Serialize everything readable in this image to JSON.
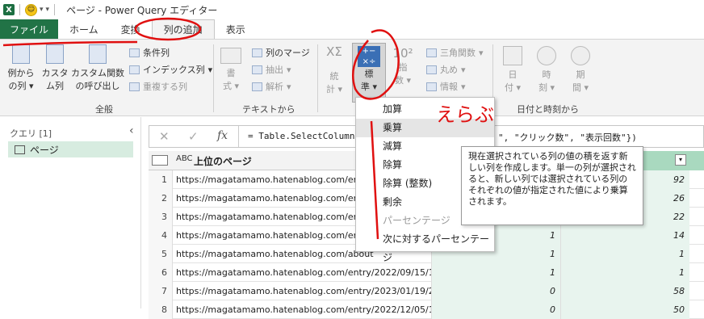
{
  "window": {
    "title": "ページ - Power Query エディター"
  },
  "tabs": [
    {
      "label": "ファイル"
    },
    {
      "label": "ホーム"
    },
    {
      "label": "変換"
    },
    {
      "label": "列の追加"
    },
    {
      "label": "表示"
    }
  ],
  "ribbon": {
    "example_col": "例から",
    "example_col2": "の列",
    "custom_col": "カスタ",
    "custom_col2": "ム列",
    "custom_fn": "カスタム関数",
    "custom_fn2": "の呼び出し",
    "conditional": "条件列",
    "index": "インデックス列",
    "duplicate": "重複する列",
    "group_general": "全般",
    "format": "書",
    "format2": "式",
    "merge": "列のマージ",
    "extract": "抽出",
    "parse": "解析",
    "group_text": "テキストから",
    "stats": "統",
    "stats2": "計",
    "standard": "標",
    "standard2": "準",
    "scientific": "指",
    "scientific2": "数",
    "trig": "三角関数",
    "round": "丸め",
    "info": "情報",
    "date": "日",
    "date2": "付",
    "time": "時",
    "time2": "刻",
    "duration": "期",
    "duration2": "間",
    "group_datetime": "日付と時刻から"
  },
  "left_panel": {
    "header": "クエリ [1]",
    "item": "ページ"
  },
  "formula": {
    "text": "= Table.SelectColumn",
    "tail": "\", \"クリック数\", \"表示回数\"})",
    "fx": "fx"
  },
  "table": {
    "col1_header": "上位のページ",
    "col3_header": "回数",
    "rows": [
      {
        "n": "1",
        "url": "https://magatamamo.hatenablog.com/entry/",
        "a": "",
        "b": "92"
      },
      {
        "n": "2",
        "url": "https://magatamamo.hatenablog.com/entry/",
        "a": "",
        "b": "26"
      },
      {
        "n": "3",
        "url": "https://magatamamo.hatenablog.com/entry/",
        "a": "",
        "b": "22"
      },
      {
        "n": "4",
        "url": "https://magatamamo.hatenablog.com/entry/",
        "a": "1",
        "b": "14"
      },
      {
        "n": "5",
        "url": "https://magatamamo.hatenablog.com/about",
        "a": "1",
        "b": "1"
      },
      {
        "n": "6",
        "url": "https://magatamamo.hatenablog.com/entry/2022/09/15/182...",
        "a": "1",
        "b": "1"
      },
      {
        "n": "7",
        "url": "https://magatamamo.hatenablog.com/entry/2023/01/19/215...",
        "a": "0",
        "b": "58"
      },
      {
        "n": "8",
        "url": "https://magatamamo.hatenablog.com/entry/2022/12/05/172...",
        "a": "0",
        "b": "50"
      }
    ]
  },
  "menu": {
    "items": [
      {
        "label": "加算"
      },
      {
        "label": "乗算"
      },
      {
        "label": "減算"
      },
      {
        "label": "除算"
      },
      {
        "label": "除算 (整数)"
      },
      {
        "label": "剰余"
      },
      {
        "label": "パーセンテージ"
      },
      {
        "label": "次に対するパーセンテージ"
      }
    ]
  },
  "tooltip": {
    "text": "現在選択されている列の値の積を返す新しい列を作成します。単一の列が選択されると、新しい列では選択されている列のそれぞれの値が指定された値により乗算されます。"
  },
  "annotation": {
    "handwritten": "えらぶ"
  },
  "colors": {
    "accent": "#217346",
    "annotation": "#e01010",
    "selected_col": "#e8f4ee"
  }
}
